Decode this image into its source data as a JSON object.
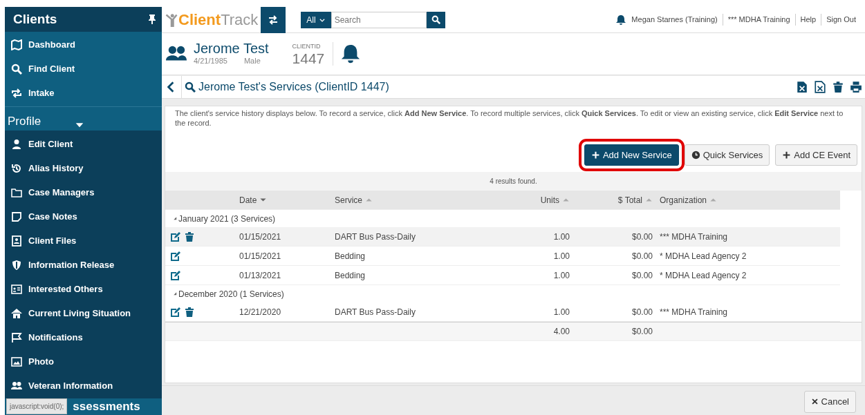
{
  "sidebar": {
    "title": "Clients",
    "top_items": [
      {
        "label": "Dashboard",
        "kind": "map"
      },
      {
        "label": "Find Client",
        "kind": "search"
      },
      {
        "label": "Intake",
        "kind": "cycle"
      }
    ],
    "section": {
      "title": "Profile",
      "expanded": true
    },
    "items": [
      {
        "label": "Edit Client",
        "kind": "user"
      },
      {
        "label": "Alias History",
        "kind": "history"
      },
      {
        "label": "Case Managers",
        "kind": "folder"
      },
      {
        "label": "Case Notes",
        "kind": "note"
      },
      {
        "label": "Client Files",
        "kind": "file"
      },
      {
        "label": "Information Release",
        "kind": "shield"
      },
      {
        "label": "Interested Others",
        "kind": "card"
      },
      {
        "label": "Current Living Situation",
        "kind": "home"
      },
      {
        "label": "Notifications",
        "kind": "flag"
      },
      {
        "label": "Photo",
        "kind": "image"
      },
      {
        "label": "Veteran Information",
        "kind": "users"
      }
    ],
    "next_section": "ssessments"
  },
  "status_tooltip": "javascript:void(0);",
  "topbar": {
    "logo_first": "Client",
    "logo_second": "Track",
    "search_scope": "All",
    "search_placeholder": "Search",
    "links": [
      "Megan Starnes (Training)",
      "*** MDHA Training",
      "Help",
      "Sign Out"
    ]
  },
  "client": {
    "name": "Jerome Test",
    "dob": "4/21/1985",
    "gender": "Male",
    "id_label": "CLIENTID",
    "id": "1447"
  },
  "page_title": "Jerome Test's Services (ClientID 1447)",
  "intro": "The client's service history displays below.  To record a service, click **Add New Service**.  To record multiple services, click **Quick Services**.  To edit or view an existing service, click **Edit Service** next to the record.",
  "buttons": [
    {
      "label": "Add New Service",
      "kind": "primary",
      "highlighted": true
    },
    {
      "label": "Quick Services",
      "kind": "clock",
      "highlighted": false
    },
    {
      "label": "Add CE Event",
      "kind": "plus",
      "highlighted": false
    }
  ],
  "results": "4 results found.",
  "table": {
    "columns": [
      {
        "label": "Date",
        "sorted_descending": true
      },
      {
        "label": "Service",
        "sorted_descending": false
      },
      {
        "label": "Units",
        "sorted_descending": false
      },
      {
        "label": "$ Total",
        "sorted_descending": false
      },
      {
        "label": "Organization",
        "sorted_descending": false
      }
    ],
    "rows": [
      {
        "kind": "group",
        "label": "January 2021 (3 Services)"
      },
      {
        "kind": "data",
        "selected": true,
        "deletable": true,
        "cells": [
          "01/15/2021",
          "DART Bus Pass-Daily",
          "1.00",
          "$0.00",
          "*** MDHA Training"
        ]
      },
      {
        "kind": "data",
        "selected": false,
        "deletable": false,
        "cells": [
          "01/15/2021",
          "Bedding",
          "1.00",
          "$0.00",
          "* MDHA Lead Agency 2"
        ]
      },
      {
        "kind": "data",
        "selected": false,
        "deletable": false,
        "cells": [
          "01/13/2021",
          "Bedding",
          "1.00",
          "$0.00",
          "* MDHA Lead Agency 2"
        ]
      },
      {
        "kind": "group",
        "label": "December 2020 (1 Services)"
      },
      {
        "kind": "data",
        "selected": false,
        "deletable": true,
        "cells": [
          "12/21/2020",
          "DART Bus Pass-Daily",
          "1.00",
          "$0.00",
          "*** MDHA Training"
        ]
      }
    ],
    "totals": [
      "4.00",
      "$0.00"
    ]
  },
  "cancel": "Cancel"
}
